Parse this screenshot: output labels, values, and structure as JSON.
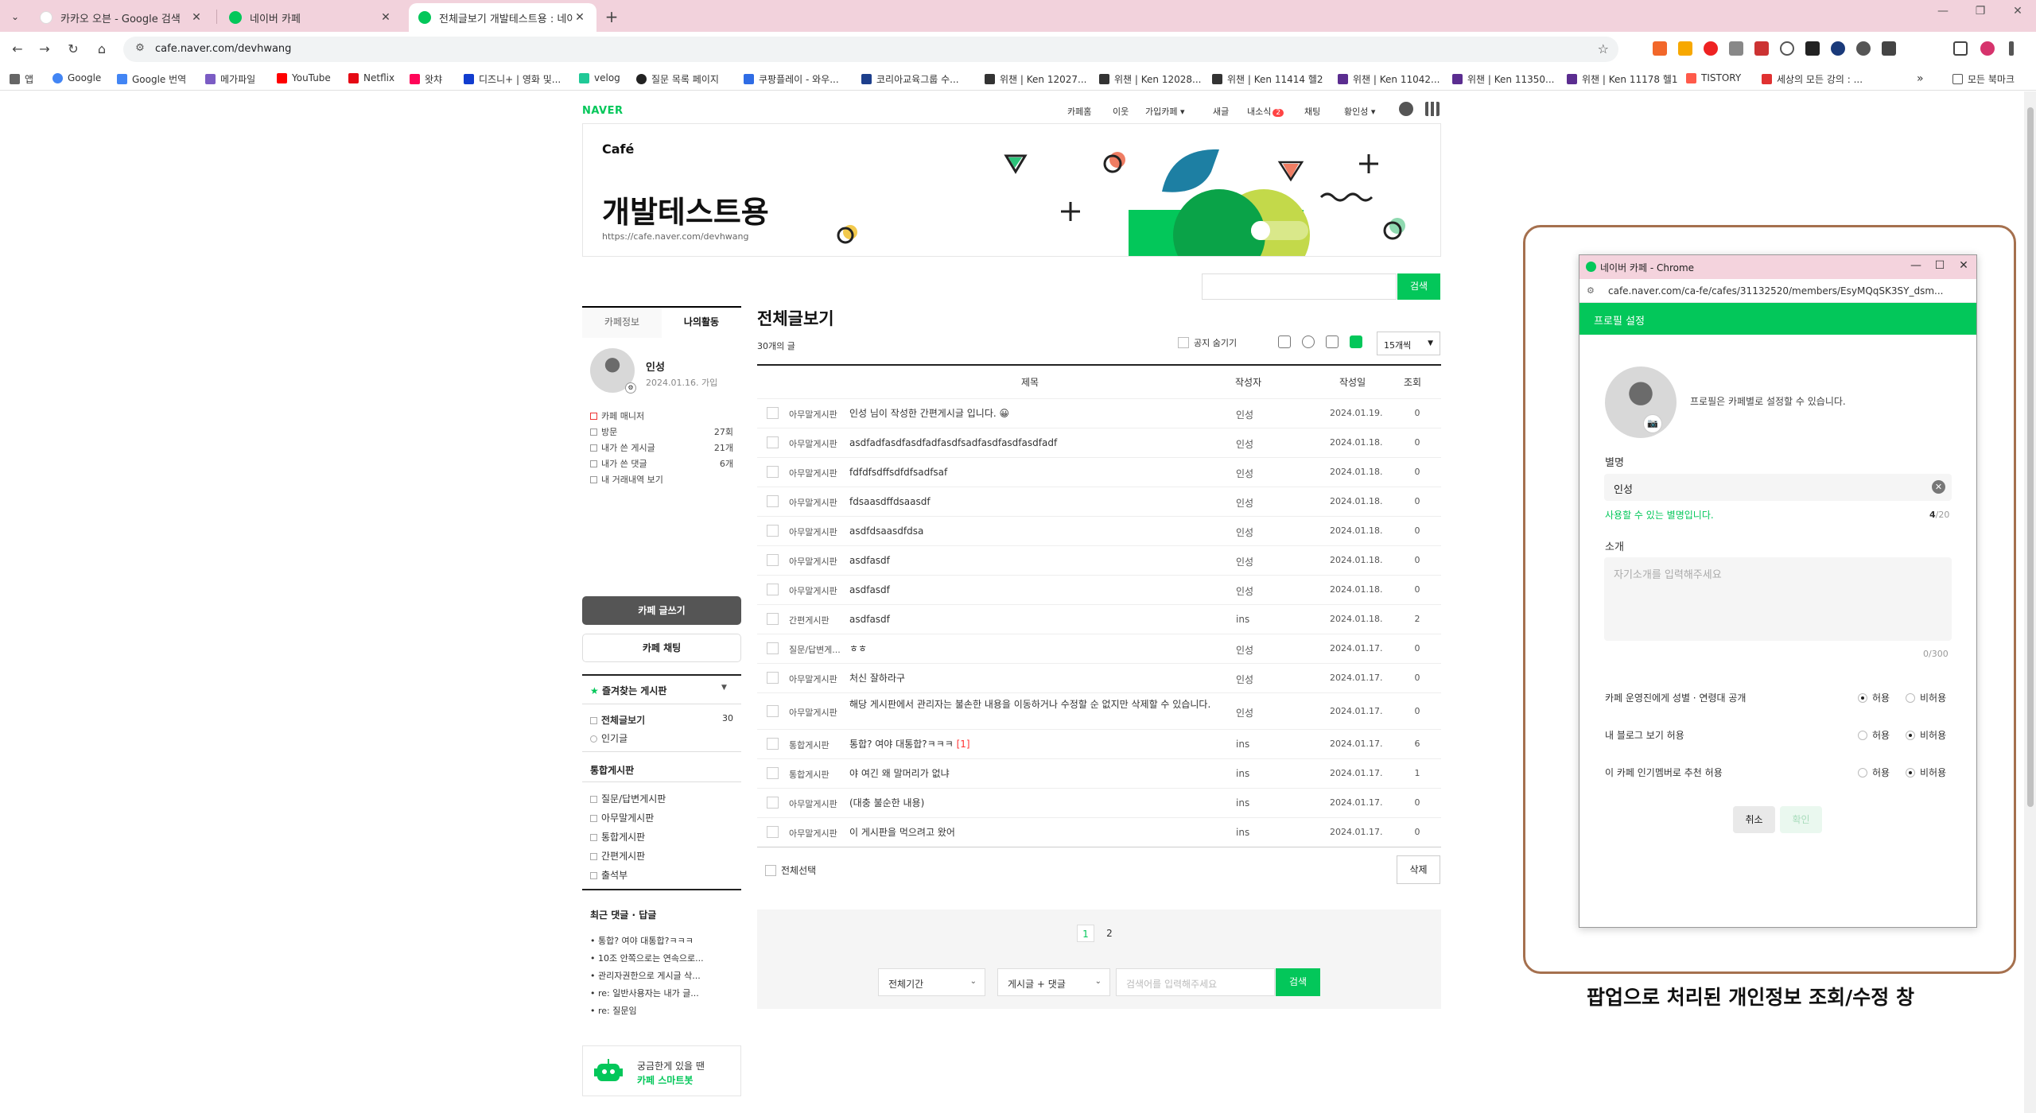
{
  "browser": {
    "tabs": [
      {
        "title": "카카오 오븐 - Google 검색",
        "active": false
      },
      {
        "title": "네이버 카페",
        "active": false
      },
      {
        "title": "전체글보기 개발테스트용 : 네이버",
        "active": true
      }
    ],
    "url": "cafe.naver.com/devhwang",
    "bookmarks": [
      "앱",
      "Google",
      "Google 번역",
      "메가파일",
      "YouTube",
      "Netflix",
      "왓챠",
      "디즈니+ | 영화 및...",
      "velog",
      "질문 목록 페이지",
      "쿠팡플레이 - 와우...",
      "코리아교육그룹 수...",
      "위챈 | Ken 12027...",
      "위챈 | Ken 12028...",
      "위챈 | Ken 11414 헬2",
      "위챈 | Ken 11042...",
      "위챈 | Ken 11350...",
      "위챈 | Ken 11178 헬1",
      "TISTORY",
      "세상의 모든 강의 : ..."
    ],
    "all_bookmarks": "모든 북마크"
  },
  "cafe_header": {
    "logo": "NAVER",
    "gnb": [
      "카페홈",
      "이웃",
      "가입카페",
      "새글",
      "내소식",
      "채팅",
      "황인성"
    ],
    "notif_count": "2",
    "cafe_label": "Café",
    "cafe_name": "개발테스트용",
    "cafe_url": "https://cafe.naver.com/devhwang",
    "search_button": "검색"
  },
  "sidebar": {
    "tabs": [
      "카페정보",
      "나의활동"
    ],
    "profile": {
      "name": "인성",
      "joined": "2024.01.16. 가입"
    },
    "stats": [
      {
        "label": "카페 매니저",
        "value": ""
      },
      {
        "label": "방문",
        "value": "27회"
      },
      {
        "label": "내가 쓴 게시글",
        "value": "21개"
      },
      {
        "label": "내가 쓴 댓글",
        "value": "6개"
      },
      {
        "label": "내 거래내역 보기",
        "value": ""
      }
    ],
    "write_button": "카페 글쓰기",
    "chat_button": "카페 채팅",
    "favorites_title": "즐겨찾는 게시판",
    "boards_top": [
      {
        "label": "전체글보기",
        "value": "30"
      },
      {
        "label": "인기글",
        "value": ""
      }
    ],
    "integrated_title": "통합게시판",
    "boards": [
      "질문/답변게시판",
      "아무말게시판",
      "통합게시판",
      "간편게시판",
      "출석부"
    ],
    "recent_title": "최근 댓글 · 답글",
    "recent": [
      "• 통합? 여야 대통합?ㅋㅋㅋ",
      "• 10조 안쪽으로는 연속으로...",
      "• 관리자권한으로 게시글 삭...",
      "• re: 일반사용자는 내가 글...",
      "• re: 질문임"
    ],
    "bot_line1": "궁금한게 있을 땐",
    "bot_line2": "카페 스마트봇"
  },
  "main": {
    "title": "전체글보기",
    "count": "30개의 글",
    "hide_notice": "공지 숨기기",
    "per_page": "15개씩",
    "columns": [
      "제목",
      "작성자",
      "작성일",
      "조회"
    ],
    "rows": [
      {
        "cat": "아무말게시판",
        "subject": "인성 님이 작성한 간편게시글 입니다. 😀",
        "comments": "",
        "author": "인성",
        "date": "2024.01.19.",
        "hits": "0"
      },
      {
        "cat": "아무말게시판",
        "subject": "asdfadfasdfasdfadfasdfsadfasdfasdfasdfadf",
        "comments": "",
        "author": "인성",
        "date": "2024.01.18.",
        "hits": "0"
      },
      {
        "cat": "아무말게시판",
        "subject": "fdfdfsdffsdfdfsadfsaf",
        "comments": "",
        "author": "인성",
        "date": "2024.01.18.",
        "hits": "0"
      },
      {
        "cat": "아무말게시판",
        "subject": "fdsaasdffdsaasdf",
        "comments": "",
        "author": "인성",
        "date": "2024.01.18.",
        "hits": "0"
      },
      {
        "cat": "아무말게시판",
        "subject": "asdfdsaasdfdsa",
        "comments": "",
        "author": "인성",
        "date": "2024.01.18.",
        "hits": "0"
      },
      {
        "cat": "아무말게시판",
        "subject": "asdfasdf",
        "comments": "",
        "author": "인성",
        "date": "2024.01.18.",
        "hits": "0"
      },
      {
        "cat": "아무말게시판",
        "subject": "asdfasdf",
        "comments": "",
        "author": "인성",
        "date": "2024.01.18.",
        "hits": "0"
      },
      {
        "cat": "간편게시판",
        "subject": "asdfasdf",
        "comments": "",
        "author": "ins",
        "date": "2024.01.18.",
        "hits": "2"
      },
      {
        "cat": "질문/답변게...",
        "subject": "ㅎㅎ",
        "comments": "",
        "author": "인성",
        "date": "2024.01.17.",
        "hits": "0"
      },
      {
        "cat": "아무말게시판",
        "subject": "처신 잘하라구",
        "comments": "",
        "author": "인성",
        "date": "2024.01.17.",
        "hits": "0"
      },
      {
        "cat": "아무말게시판",
        "subject": "해당 게시판에서 관리자는 불손한 내용을 이동하거나 수정할 순 없지만 삭제할 수 있습니다.",
        "comments": "",
        "author": "인성",
        "date": "2024.01.17.",
        "hits": "0"
      },
      {
        "cat": "통합게시판",
        "subject": "통합? 여야 대통합?ㅋㅋㅋ",
        "comments": "[1]",
        "author": "ins",
        "date": "2024.01.17.",
        "hits": "6"
      },
      {
        "cat": "통합게시판",
        "subject": "야 여긴 왜 말머리가 없냐",
        "comments": "",
        "author": "ins",
        "date": "2024.01.17.",
        "hits": "1"
      },
      {
        "cat": "아무말게시판",
        "subject": "(대충 불순한 내용)",
        "comments": "",
        "author": "ins",
        "date": "2024.01.17.",
        "hits": "0"
      },
      {
        "cat": "아무말게시판",
        "subject": "이 게시판을 먹으려고 왔어",
        "comments": "",
        "author": "ins",
        "date": "2024.01.17.",
        "hits": "0"
      }
    ],
    "select_all": "전체선택",
    "delete_button": "삭제",
    "pages": [
      "1",
      "2"
    ],
    "period_select": "전체기간",
    "type_select": "게시글 + 댓글",
    "keyword_placeholder": "검색어를 입력해주세요",
    "search_button": "검색"
  },
  "popup": {
    "window_title": "네이버 카페 - Chrome",
    "url": "cafe.naver.com/ca-fe/cafes/31132520/members/EsyMQqSK3SY_dsm...",
    "header": "프로필 설정",
    "hint": "프로필은 카페별로 설정할 수 있습니다.",
    "nickname_label": "별명",
    "nickname_value": "인성",
    "nickname_ok": "사용할 수 있는 별명입니다.",
    "nickname_count": "4",
    "nickname_max": "/20",
    "intro_label": "소개",
    "intro_placeholder": "자기소개를 입력해주세요",
    "intro_count": "0/300",
    "prefs": [
      {
        "label": "카페 운영진에게 성별 · 연령대 공개",
        "selected": "allow"
      },
      {
        "label": "내 블로그 보기 허용",
        "selected": "deny"
      },
      {
        "label": "이 카페 인기멤버로 추천 허용",
        "selected": "deny"
      }
    ],
    "allow_label": "허용",
    "deny_label": "비허용",
    "cancel": "취소",
    "confirm": "확인"
  },
  "caption": "팝업으로 처리된 개인정보 조회/수정 창",
  "colors": {
    "naver_green": "#03c75a",
    "annotation_frame": "#a5704e",
    "tabstrip": "#f2d2dc"
  }
}
